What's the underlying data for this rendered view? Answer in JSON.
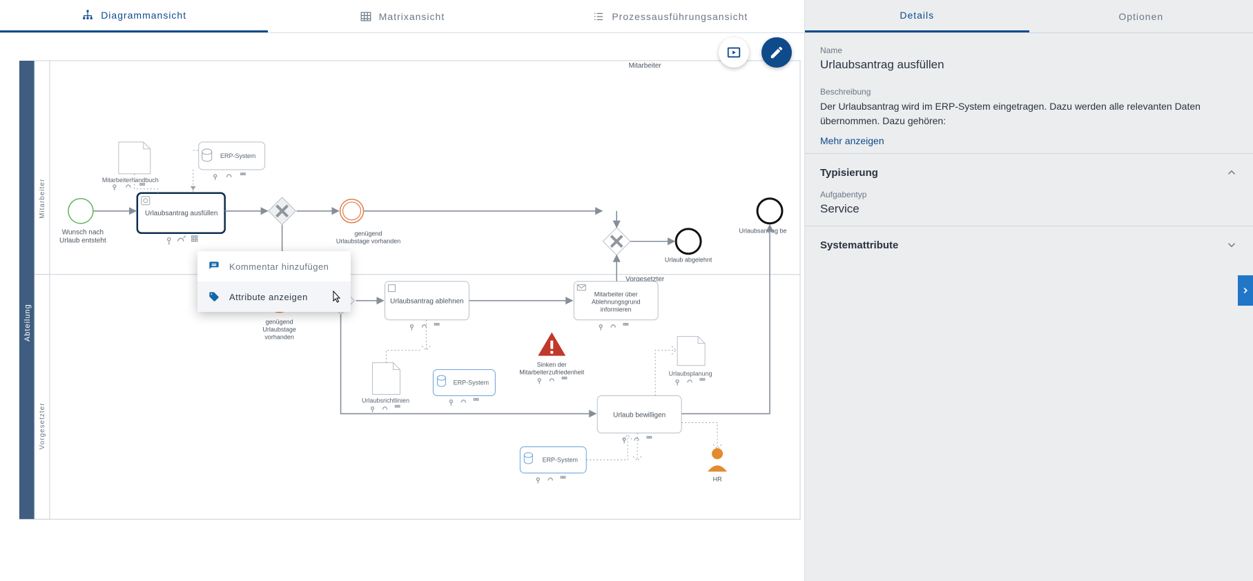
{
  "tabs": {
    "diagram": "Diagrammansicht",
    "matrix": "Matrixansicht",
    "execution": "Prozessausführungsansicht"
  },
  "contextMenu": {
    "addComment": "Kommentar hinzufügen",
    "showAttributes": "Attribute anzeigen"
  },
  "rightTabs": {
    "details": "Details",
    "options": "Optionen"
  },
  "details": {
    "nameLabel": "Name",
    "nameValue": "Urlaubsantrag ausfüllen",
    "descLabel": "Beschreibung",
    "descValue": "Der Urlaubsantrag wird im ERP-System eingetragen. Dazu werden alle relevanten Daten übernommen. Dazu gehören:",
    "showMore": "Mehr anzeigen",
    "typingHeader": "Typisierung",
    "taskTypeLabel": "Aufgabentyp",
    "taskTypeValue": "Service",
    "sysAttrHeader": "Systemattribute"
  },
  "diagram": {
    "pool": "Abteilung",
    "laneEmployee": "Mitarbeiter",
    "laneSupervisor": "Vorgesetzter",
    "laneEmployeeTop": "Mitarbeiter",
    "laneSupervisorMid": "Vorgesetzter",
    "startEvent": "Wunsch nach Urlaub entsteht",
    "taskFill": "Urlaubsantrag ausfüllen",
    "handbook": "Mitarbeiterhandbuch",
    "erp": "ERP-System",
    "gw1a": "genügend",
    "gw1b": "Urlaubstage vorhanden",
    "gw2a": "genügend",
    "gw2b": "Urlaubstage",
    "gw2c": "vorhanden",
    "taskReject": "Urlaubsantrag ablehnen",
    "taskInform1": "Mitarbeiter über",
    "taskInform2": "Ablehnungsgrund",
    "taskInform3": "informieren",
    "taskApprove": "Urlaub bewilligen",
    "policies": "Urlaubsrichtlinien",
    "planning": "Urlaubsplanung",
    "risk1": "Sinken der",
    "risk2": "Mitarbeiterzufriedenheit",
    "endReject": "Urlaub abgelehnt",
    "endApprove": "Urlaubsantrag be",
    "hr": "HR"
  }
}
